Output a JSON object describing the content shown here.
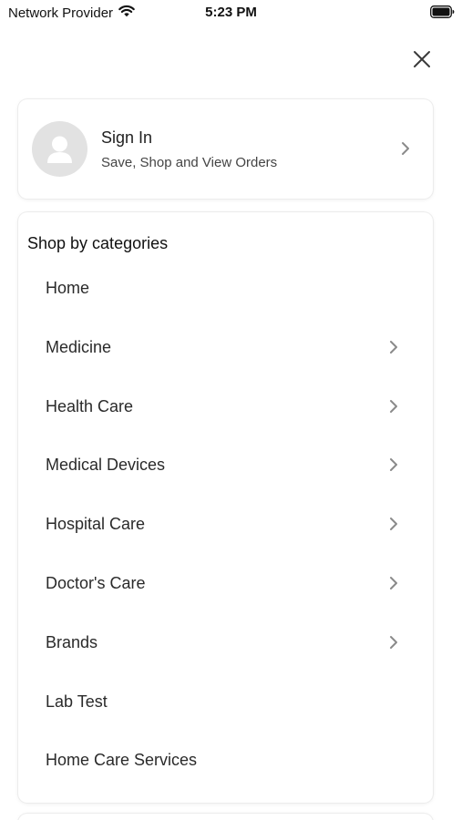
{
  "status_bar": {
    "carrier": "Network Provider",
    "time": "5:23 PM",
    "wifi_icon": "wifi-icon",
    "battery_icon": "battery-icon"
  },
  "close_icon": "close-icon",
  "sign_in": {
    "title": "Sign In",
    "subtitle": "Save, Shop and View Orders",
    "avatar_icon": "user-avatar-icon"
  },
  "categories": {
    "heading": "Shop by categories",
    "items": [
      {
        "label": "Home",
        "has_chevron": false
      },
      {
        "label": "Medicine",
        "has_chevron": true
      },
      {
        "label": "Health Care",
        "has_chevron": true
      },
      {
        "label": "Medical Devices",
        "has_chevron": true
      },
      {
        "label": "Hospital Care",
        "has_chevron": true
      },
      {
        "label": "Doctor's Care",
        "has_chevron": true
      },
      {
        "label": "Brands",
        "has_chevron": true
      },
      {
        "label": "Lab Test",
        "has_chevron": false
      },
      {
        "label": "Home Care Services",
        "has_chevron": false
      }
    ]
  },
  "colors": {
    "background": "#ffffff",
    "text": "#1f1f1f",
    "chevron": "#8a8a8a",
    "avatar_bg": "#e2e2e2"
  }
}
